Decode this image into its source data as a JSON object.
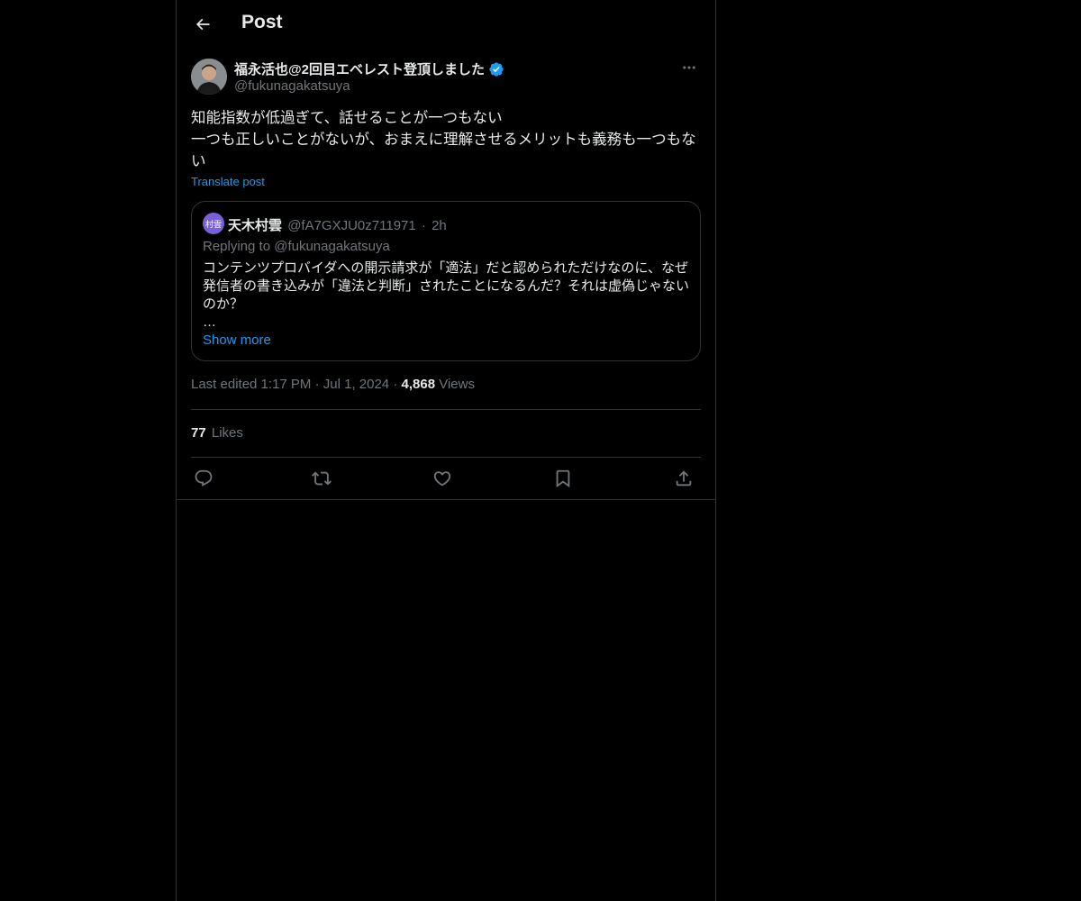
{
  "header": {
    "title": "Post"
  },
  "author": {
    "name": "福永活也@2回目エベレスト登頂しました",
    "handle": "@fukunagakatsuya",
    "verified": true
  },
  "post": {
    "text": "知能指数が低過ぎて、話せることが一つもない\n一つも正しいことがないが、おまえに理解させるメリットも義務も一つもない",
    "translate_label": "Translate post"
  },
  "quote": {
    "avatar_text": "村雲",
    "name": "天木村雲",
    "handle": "@fA7GXJU0z711971",
    "separator": "·",
    "time": "2h",
    "replying_to": "Replying to @fukunagakatsuya",
    "text": "コンテンツプロバイダへの開示請求が「適法」だと認められただけなのに、なぜ発信者の書き込みが「違法と判断」されたことになるんだ？それは虚偽じゃないのか？\n…",
    "show_more": "Show more"
  },
  "meta": {
    "edited_label": "Last edited 1:17 PM",
    "sep": "·",
    "date": "Jul 1, 2024",
    "views_count": "4,868",
    "views_label": "Views"
  },
  "stats": {
    "likes_count": "77",
    "likes_label": "Likes"
  },
  "colors": {
    "accent": "#1d9bf0",
    "background": "#000000",
    "muted": "#71767b",
    "border": "#2f3336"
  },
  "icons": [
    "back-arrow-icon",
    "verified-badge-icon",
    "more-icon",
    "reply-icon",
    "repost-icon",
    "like-icon",
    "bookmark-icon",
    "share-icon"
  ]
}
